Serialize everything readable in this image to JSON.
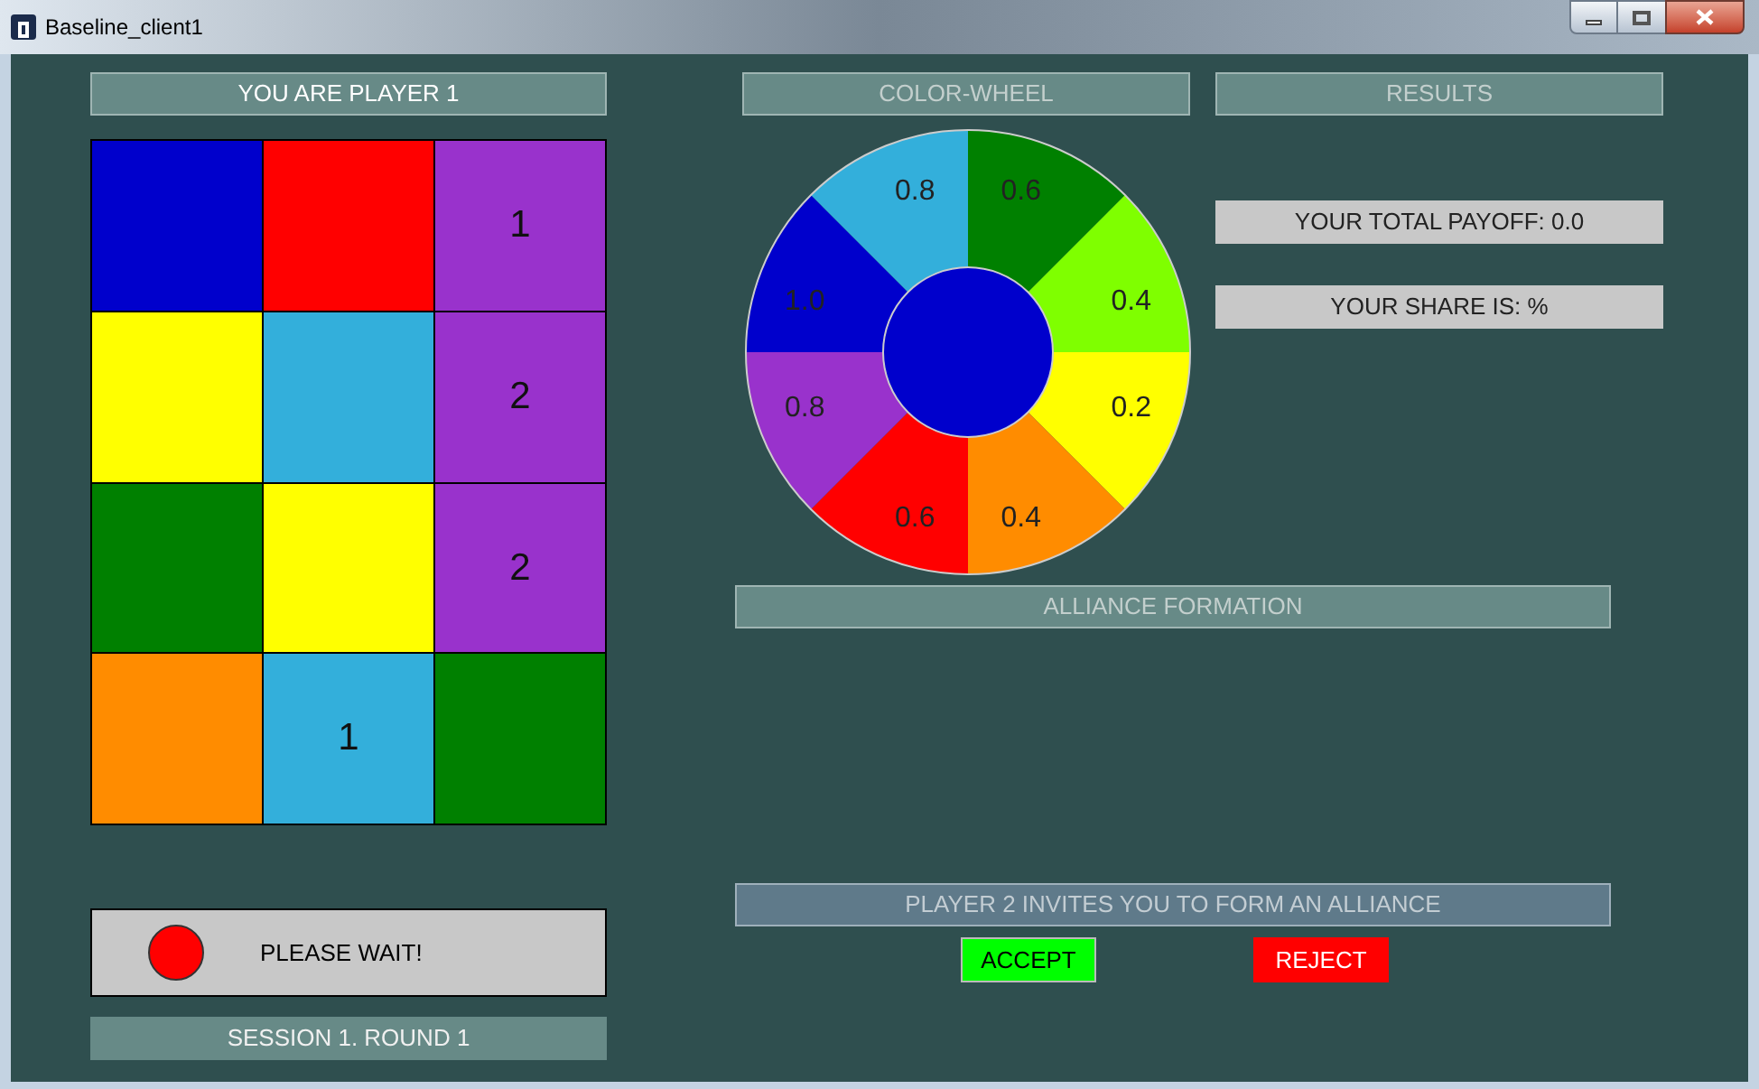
{
  "window": {
    "title": "Baseline_client1"
  },
  "player_header": "YOU ARE PLAYER 1",
  "board": {
    "cells": [
      {
        "color": "#0000cc"
      },
      {
        "color": "#ff0000"
      },
      {
        "color": "#9932cc",
        "label": "1"
      },
      {
        "color": "#ffff00"
      },
      {
        "color": "#33afdb"
      },
      {
        "color": "#9932cc",
        "label": "2"
      },
      {
        "color": "#008000"
      },
      {
        "color": "#ffff00"
      },
      {
        "color": "#9932cc",
        "label": "2"
      },
      {
        "color": "#ff8c00"
      },
      {
        "color": "#33afdb",
        "label": "1"
      },
      {
        "color": "#008000"
      }
    ]
  },
  "status": {
    "color": "#ff0000",
    "text": "PLEASE WAIT!"
  },
  "session": "SESSION 1. ROUND 1",
  "color_wheel": {
    "title": "COLOR-WHEEL",
    "segments": [
      {
        "label": "0.6",
        "color": "#008000"
      },
      {
        "label": "0.4",
        "color": "#7fff00"
      },
      {
        "label": "0.2",
        "color": "#ffff00"
      },
      {
        "label": "0.4",
        "color": "#ff8c00"
      },
      {
        "label": "0.6",
        "color": "#ff0000"
      },
      {
        "label": "0.8",
        "color": "#9932cc"
      },
      {
        "label": "1.0",
        "color": "#0000cc"
      },
      {
        "label": "0.8",
        "color": "#33afdb"
      }
    ]
  },
  "results": {
    "title": "RESULTS",
    "payoff": "YOUR TOTAL PAYOFF: 0.0",
    "share": "YOUR SHARE IS: %"
  },
  "alliance": {
    "title": "ALLIANCE FORMATION",
    "invitation": "PLAYER 2 INVITES YOU TO FORM AN ALLIANCE",
    "buttons": [
      {
        "label": "ACCEPT",
        "kind": "accept"
      },
      {
        "label": "REJECT",
        "kind": "reject"
      }
    ]
  }
}
